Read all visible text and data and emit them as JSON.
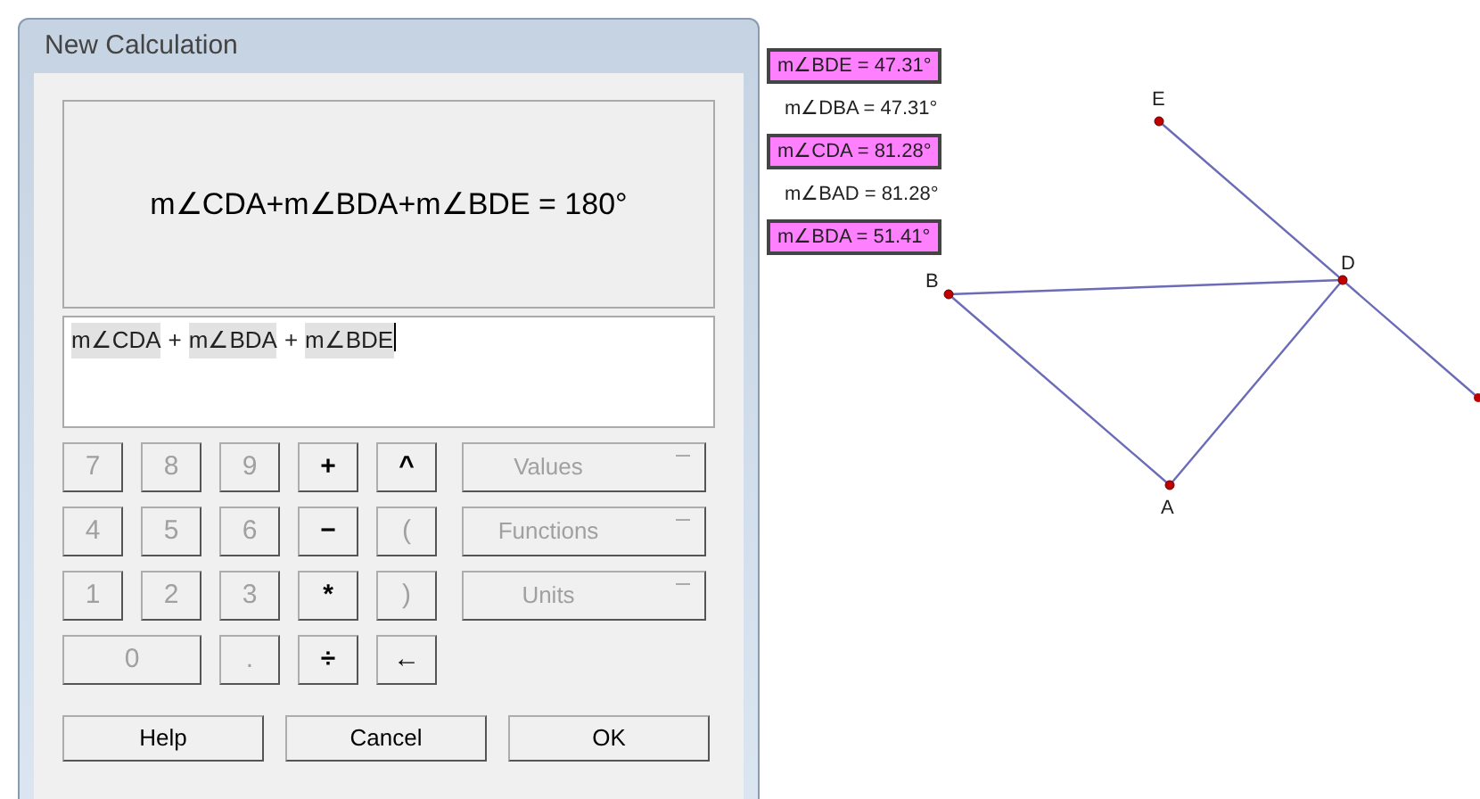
{
  "window": {
    "title": "New Calculation"
  },
  "display": {
    "result": "m∠CDA+m∠BDA+m∠BDE = 180°"
  },
  "expression": {
    "tokens": [
      {
        "text": "m∠CDA",
        "kind": "measure"
      },
      {
        "text": "+",
        "kind": "operator"
      },
      {
        "text": "m∠BDA",
        "kind": "measure"
      },
      {
        "text": "+",
        "kind": "operator"
      },
      {
        "text": "m∠BDE",
        "kind": "measure"
      }
    ]
  },
  "keypad": [
    [
      {
        "label": "7",
        "disabled": true
      },
      {
        "label": "8",
        "disabled": true
      },
      {
        "label": "9",
        "disabled": true
      },
      {
        "label": "+",
        "disabled": false
      },
      {
        "label": "^",
        "disabled": false
      }
    ],
    [
      {
        "label": "4",
        "disabled": true
      },
      {
        "label": "5",
        "disabled": true
      },
      {
        "label": "6",
        "disabled": true
      },
      {
        "label": "−",
        "disabled": false
      },
      {
        "label": "(",
        "disabled": true
      }
    ],
    [
      {
        "label": "1",
        "disabled": true
      },
      {
        "label": "2",
        "disabled": true
      },
      {
        "label": "3",
        "disabled": true
      },
      {
        "label": "*",
        "disabled": false
      },
      {
        "label": ")",
        "disabled": true
      }
    ],
    [
      {
        "label": "0",
        "disabled": true,
        "wide": true
      },
      {
        "label": ".",
        "disabled": true
      },
      {
        "label": "÷",
        "disabled": false
      },
      {
        "label": "←",
        "disabled": false
      }
    ]
  ],
  "menus": [
    {
      "label": "Values",
      "disabled": true
    },
    {
      "label": "Functions",
      "disabled": true
    },
    {
      "label": "Units",
      "disabled": true
    }
  ],
  "buttons": [
    "Help",
    "Cancel",
    "OK"
  ],
  "measurements": [
    {
      "text": "m∠BDE = 47.31°",
      "selected": true
    },
    {
      "text": "m∠DBA = 47.31°",
      "selected": false
    },
    {
      "text": "m∠CDA = 81.28°",
      "selected": true
    },
    {
      "text": "m∠BAD = 81.28°",
      "selected": false
    },
    {
      "text": "m∠BDA = 51.41°",
      "selected": true
    }
  ],
  "points": [
    {
      "label": "E"
    },
    {
      "label": "D"
    },
    {
      "label": "B"
    },
    {
      "label": "A"
    }
  ]
}
